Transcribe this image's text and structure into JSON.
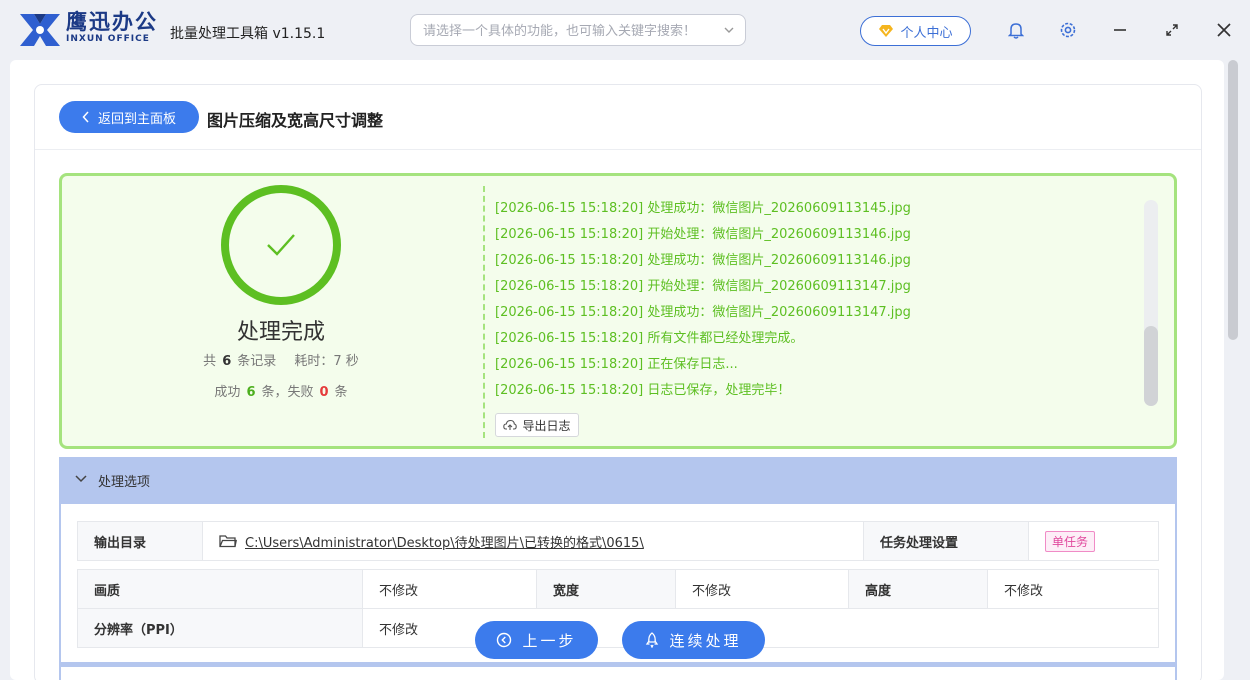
{
  "app": {
    "brand_cn": "鹰迅办公",
    "brand_en": "INXUN OFFICE",
    "title": "批量处理工具箱 v1.15.1"
  },
  "search": {
    "placeholder": "请选择一个具体的功能，也可输入关键字搜索！"
  },
  "header": {
    "user_center": "个人中心"
  },
  "page": {
    "back_label": "返回到主面板",
    "title": "图片压缩及宽高尺寸调整"
  },
  "result": {
    "status": "处理完成",
    "total_prefix": "共",
    "total": "6",
    "total_suffix": "条记录",
    "elapsed_prefix": "耗时：",
    "elapsed": "7 秒",
    "success_prefix": "成功",
    "success": "6",
    "success_suffix": "条，失败",
    "fail": "0",
    "fail_suffix": "条"
  },
  "log": {
    "lines": [
      "[2026-06-15 15:18:20] 处理成功：微信图片_20260609113145.jpg",
      "[2026-06-15 15:18:20] 开始处理：微信图片_20260609113146.jpg",
      "[2026-06-15 15:18:20] 处理成功：微信图片_20260609113146.jpg",
      "[2026-06-15 15:18:20] 开始处理：微信图片_20260609113147.jpg",
      "[2026-06-15 15:18:20] 处理成功：微信图片_20260609113147.jpg",
      "[2026-06-15 15:18:20] 所有文件都已经处理完成。",
      "[2026-06-15 15:18:20] 正在保存日志...",
      "[2026-06-15 15:18:20] 日志已保存，处理完毕！"
    ],
    "export_label": "导出日志"
  },
  "options": {
    "header": "处理选项",
    "output_dir_label": "输出目录",
    "output_dir": "C:\\Users\\Administrator\\Desktop\\待处理图片\\已转换的格式\\0615\\",
    "task_setting_label": "任务处理设置",
    "task_setting": "单任务",
    "quality_label": "画质",
    "quality": "不修改",
    "width_label": "宽度",
    "width": "不修改",
    "height_label": "高度",
    "height": "不修改",
    "ppi_label": "分辨率（PPI）",
    "ppi": "不修改"
  },
  "buttons": {
    "prev": "上一步",
    "continue": "连续处理"
  },
  "colors": {
    "accent": "#3c7bec",
    "success": "#5dbf22",
    "fail": "#e53b3b",
    "panel": "#b4c6ee"
  }
}
